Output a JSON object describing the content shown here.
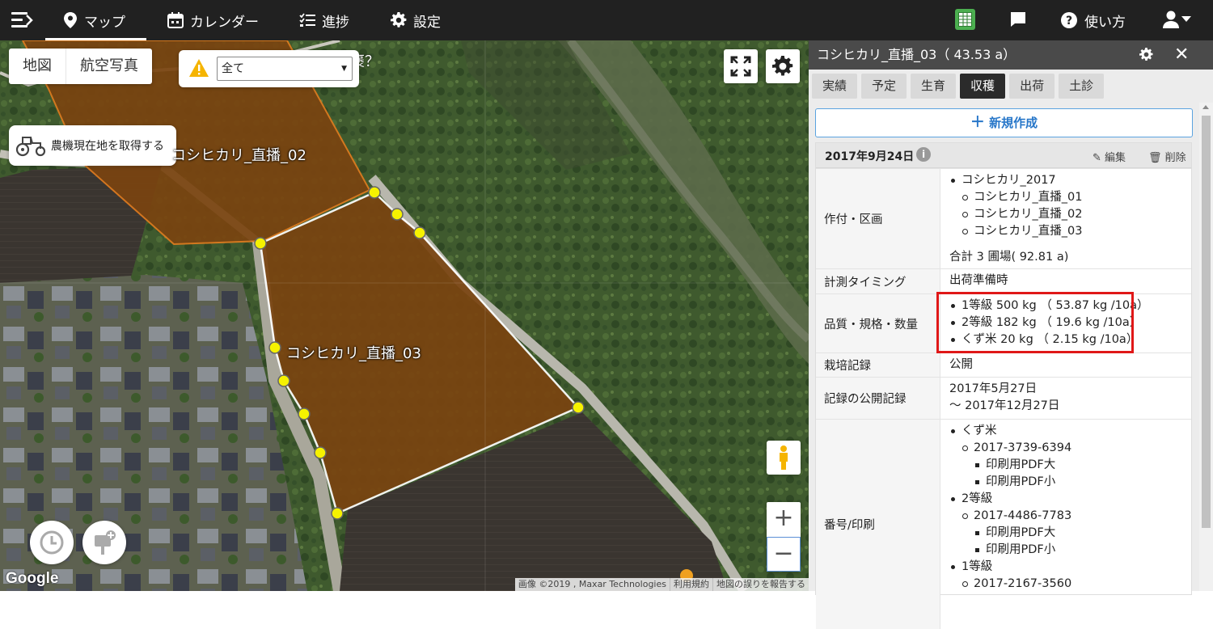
{
  "topbar": {
    "nav": [
      {
        "label": "マップ",
        "icon": "map-pin-icon",
        "active": true
      },
      {
        "label": "カレンダー",
        "icon": "calendar-icon"
      },
      {
        "label": "進捗",
        "icon": "checklist-icon"
      },
      {
        "label": "設定",
        "icon": "gear-icon"
      }
    ],
    "help_label": "使い方"
  },
  "map": {
    "maptype": [
      "地図",
      "航空写真"
    ],
    "filter_value": "全て",
    "tractor_button": "農機現在地を取得する",
    "partial_text": "褒？",
    "fields": [
      {
        "label": "コシヒカリ_直播_02"
      },
      {
        "label": "コシヒカリ_直播_03"
      }
    ],
    "watermark": "© 2019 Google",
    "google": "Google",
    "attribution": [
      "画像 ©2019 , Maxar Technologies",
      "利用規約",
      "地図の誤りを報告する"
    ],
    "zoom_in": "+",
    "zoom_out": "−"
  },
  "panel": {
    "title": "コシヒカリ_直播_03（ 43.53 a）",
    "tabs": [
      "実績",
      "予定",
      "生育",
      "収穫",
      "出荷",
      "土診"
    ],
    "active_tab": "収穫",
    "new_button": "新規作成",
    "record": {
      "date": "2017年9月24日",
      "edit": "編集",
      "delete": "削除",
      "crop_label": "作付・区画",
      "crop": "コシヒカリ_2017",
      "sections": [
        "コシヒカリ_直播_01",
        "コシヒカリ_直播_02",
        "コシヒカリ_直播_03"
      ],
      "total": "合計 3 圃場( 92.81 a)",
      "timing_label": "計測タイミング",
      "timing": "出荷準備時",
      "quality_label": "品質・規格・数量",
      "quality": [
        "1等級 500 kg （ 53.87 kg /10a）",
        "2等級 182 kg （ 19.6 kg /10a）",
        "くず米 20 kg （ 2.15 kg /10a）"
      ],
      "cultivation_label": "栽培記録",
      "cultivation": "公開",
      "public_label": "記録の公開記録",
      "public_from": "2017年5月27日",
      "public_to": "～ 2017年12月27日",
      "print_label": "番号/印刷",
      "print_groups": [
        {
          "grade": "くず米",
          "number": "2017-3739-6394",
          "links": [
            "印刷用PDF大",
            "印刷用PDF小"
          ]
        },
        {
          "grade": "2等級",
          "number": "2017-4486-7783",
          "links": [
            "印刷用PDF大",
            "印刷用PDF小"
          ]
        },
        {
          "grade": "1等級",
          "number": "2017-2167-3560",
          "links": []
        }
      ]
    }
  },
  "colors": {
    "topbar": "#212121",
    "highlight": "#e01818",
    "accent": "#2877c9",
    "field_fill": "#7a4410"
  }
}
